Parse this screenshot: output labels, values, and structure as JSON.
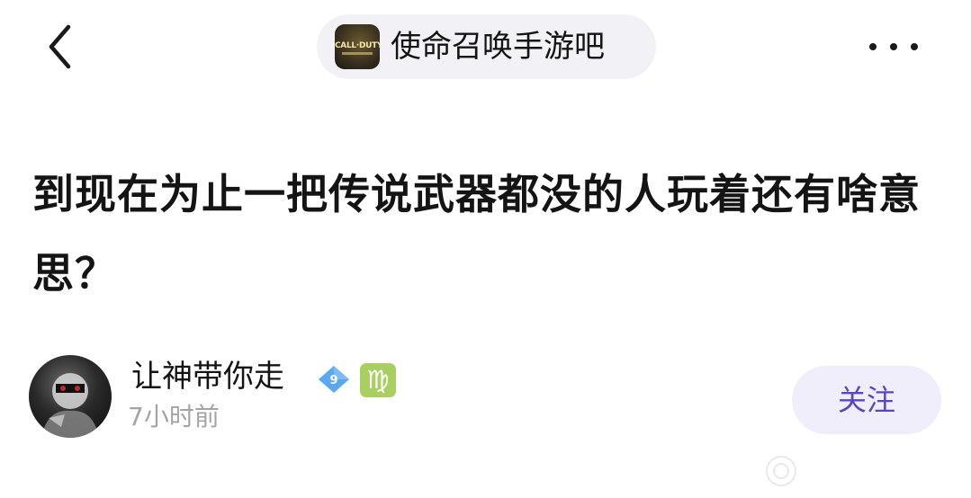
{
  "nav": {
    "back_icon": "chevron-left-icon",
    "more_icon": "more-horizontal-icon",
    "forum": {
      "name": "使命召唤手游吧",
      "logo_text": "CALL·DUTY"
    }
  },
  "post": {
    "title": "到现在为止一把传说武器都没的人玩着还有啥意思？"
  },
  "author": {
    "name": "让神带你走",
    "level": "9",
    "zodiac_symbol": "♍",
    "time": "7小时前"
  },
  "follow": {
    "label": "关注"
  },
  "colors": {
    "accent": "#5a46c2",
    "follow_bg": "#f1eefb",
    "pill_bg": "#f2f2f6",
    "level_badge": "#5aa8f0",
    "zodiac_badge": "#a9cf63",
    "time_text": "#a4a4a8"
  }
}
